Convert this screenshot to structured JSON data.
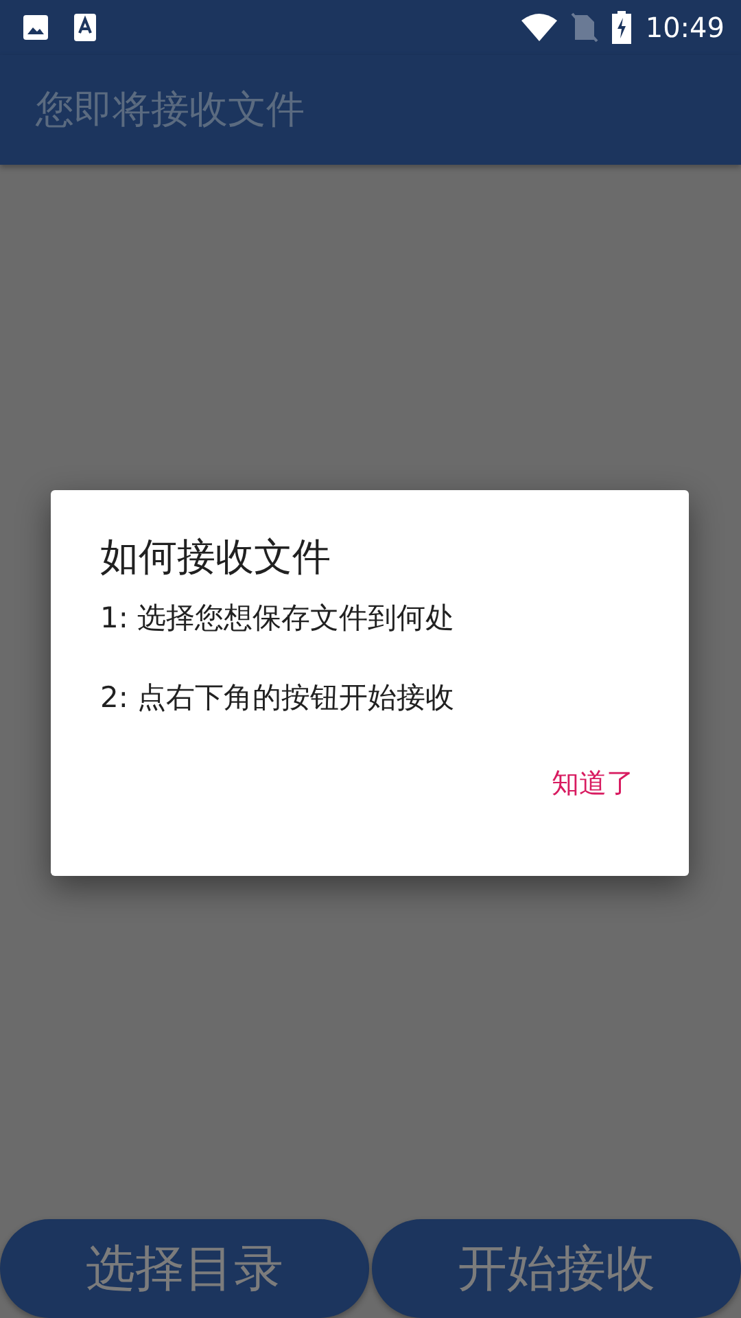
{
  "status_bar": {
    "time": "10:49"
  },
  "app_bar": {
    "title": "您即将接收文件"
  },
  "dialog": {
    "title": "如何接收文件",
    "lines": [
      "1: 选择您想保存文件到何处",
      "2: 点右下角的按钮开始接收"
    ],
    "action": "知道了"
  },
  "buttons": [
    "选择目录",
    "开始接收"
  ]
}
